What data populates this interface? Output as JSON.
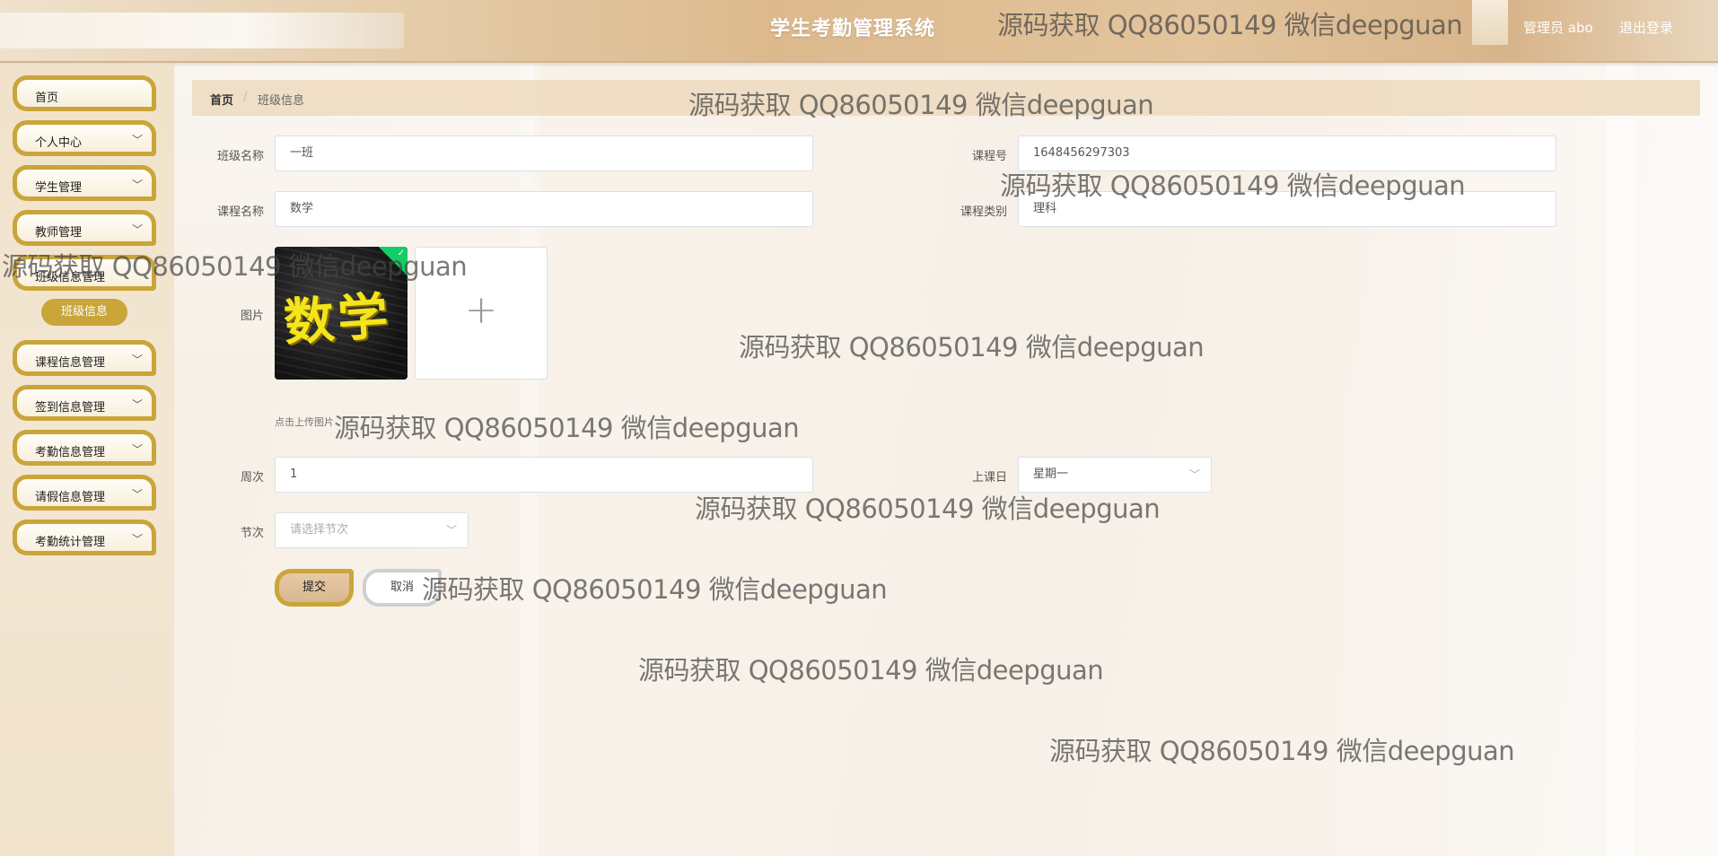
{
  "header": {
    "title": "学生考勤管理系统",
    "user": "管理员 abo",
    "logout": "退出登录"
  },
  "sidebar": {
    "items": [
      {
        "label": "首页",
        "chev": ""
      },
      {
        "label": "个人中心",
        "chev": "﹀"
      },
      {
        "label": "学生管理",
        "chev": "﹀"
      },
      {
        "label": "教师管理",
        "chev": "﹀"
      },
      {
        "label": "班级信息管理",
        "chev": ""
      },
      {
        "label": "课程信息管理",
        "chev": "﹀"
      },
      {
        "label": "签到信息管理",
        "chev": "﹀"
      },
      {
        "label": "考勤信息管理",
        "chev": "﹀"
      },
      {
        "label": "请假信息管理",
        "chev": "﹀"
      },
      {
        "label": "考勤统计管理",
        "chev": "﹀"
      }
    ],
    "sub_active": "班级信息"
  },
  "breadcrumb": {
    "home": "首页",
    "sep": "/",
    "current": "班级信息"
  },
  "form": {
    "class_name_label": "班级名称",
    "class_name_value": "一班",
    "course_no_label": "课程号",
    "course_no_value": "1648456297303",
    "course_name_label": "课程名称",
    "course_name_value": "数学",
    "course_type_label": "课程类别",
    "course_type_value": "理科",
    "image_label": "图片",
    "image_text": "数学",
    "uploader_plus": "+",
    "upload_tip": "点击上传图片",
    "week_label": "周次",
    "week_value": "1",
    "day_label": "上课日",
    "day_value": "星期一",
    "section_label": "节次",
    "section_placeholder": "请选择节次",
    "submit": "提交",
    "cancel": "取消",
    "chev": "﹀"
  },
  "watermark": "源码获取 QQ86050149 微信deepguan",
  "colors": {
    "accent": "#c9a53a",
    "success": "#13ce66"
  }
}
